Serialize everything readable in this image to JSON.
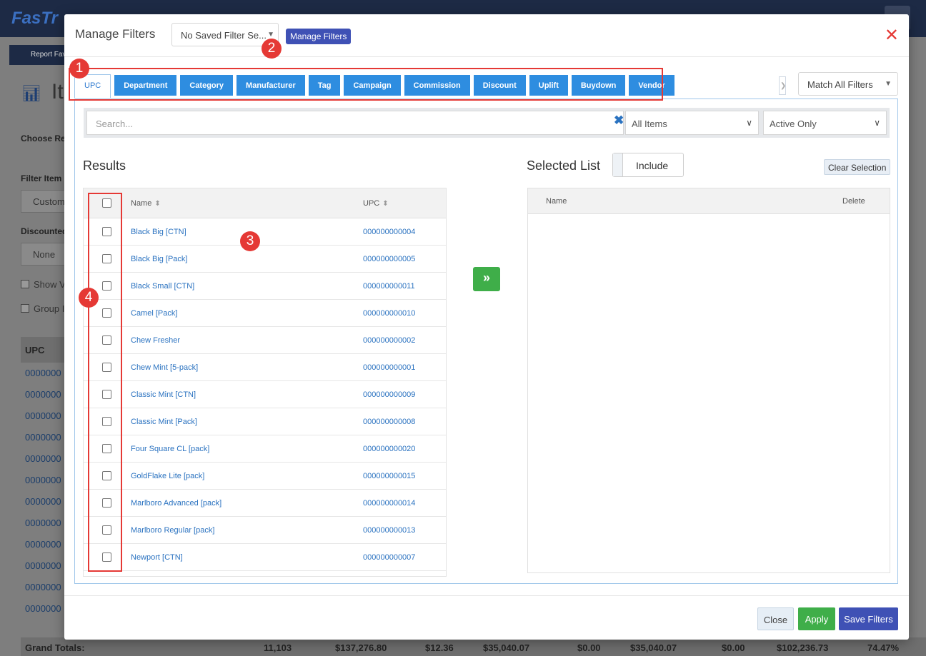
{
  "background": {
    "logo": "FasTr",
    "report_favorites": "Report Fav",
    "page_title": "It",
    "choose_report_label": "Choose Rep",
    "filter_items_label": "Filter Item",
    "filter_items_value": "Custom",
    "discounted_label": "Discounted",
    "discounted_value": "None",
    "show_checkbox": "Show V",
    "group_checkbox": "Group I",
    "table_header": "UPC",
    "rows": [
      "0000000",
      "0000000",
      "0000000",
      "0000000",
      "0000000",
      "0000000",
      "0000000",
      "0000000",
      "0000000",
      "0000000",
      "0000000",
      "0000000"
    ],
    "grand_totals": {
      "label": "Grand Totals:",
      "values": [
        "11,103",
        "$137,276.80",
        "$12.36",
        "$35,040.07",
        "$0.00",
        "$35,040.07",
        "$0.00",
        "$102,236.73",
        "74.47%"
      ]
    }
  },
  "modal": {
    "title": "Manage Filters",
    "saved_filter_select": "No Saved Filter Se...",
    "manage_filters_button": "Manage Filters",
    "tabs": [
      "UPC",
      "Department",
      "Category",
      "Manufacturer",
      "Tag",
      "Campaign",
      "Commission",
      "Discount",
      "Uplift",
      "Buydown",
      "Vendor"
    ],
    "match_select": "Match All Filters",
    "search": {
      "placeholder": "Search..."
    },
    "items_select": "All Items",
    "status_select": "Active Only",
    "results": {
      "title": "Results",
      "columns": [
        "Name",
        "UPC"
      ],
      "rows": [
        {
          "name": "Black Big [CTN]",
          "upc": "000000000004"
        },
        {
          "name": "Black Big [Pack]",
          "upc": "000000000005"
        },
        {
          "name": "Black Small [CTN]",
          "upc": "000000000011"
        },
        {
          "name": "Camel [Pack]",
          "upc": "000000000010"
        },
        {
          "name": "Chew Fresher",
          "upc": "000000000002"
        },
        {
          "name": "Chew Mint [5-pack]",
          "upc": "000000000001"
        },
        {
          "name": "Classic Mint [CTN]",
          "upc": "000000000009"
        },
        {
          "name": "Classic Mint [Pack]",
          "upc": "000000000008"
        },
        {
          "name": "Four Square CL [pack]",
          "upc": "000000000020"
        },
        {
          "name": "GoldFlake Lite [pack]",
          "upc": "000000000015"
        },
        {
          "name": "Marlboro Advanced [pack]",
          "upc": "000000000014"
        },
        {
          "name": "Marlboro Regular [pack]",
          "upc": "000000000013"
        },
        {
          "name": "Newport [CTN]",
          "upc": "000000000007"
        }
      ]
    },
    "move_button": "»",
    "selected": {
      "title": "Selected List",
      "toggle_label": "Include",
      "clear_button": "Clear Selection",
      "columns": [
        "Name",
        "Delete"
      ]
    },
    "footer": {
      "close": "Close",
      "apply": "Apply",
      "save": "Save Filters"
    }
  },
  "annotations": [
    "1",
    "2",
    "3",
    "4"
  ],
  "colors": {
    "tab_blue": "#2e8de0",
    "primary_indigo": "#3f51b5",
    "success_green": "#3fae49",
    "annotation_red": "#e53935",
    "link_blue": "#2a72c0"
  }
}
